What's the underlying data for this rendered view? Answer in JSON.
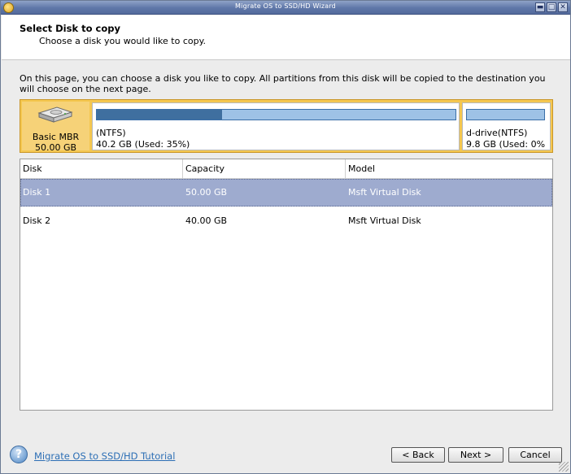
{
  "window": {
    "title": "Migrate OS to SSD/HD Wizard",
    "minimize_glyph": "▬",
    "maximize_glyph": "□",
    "close_glyph": "✕"
  },
  "header": {
    "title": "Select Disk to copy",
    "subtitle": "Choose a disk you would like to copy."
  },
  "intro": "On this page, you can choose a disk you like to copy. All partitions from this disk will be copied to the destination you will choose on the next page.",
  "disk_map": {
    "disk_type": "Basic MBR",
    "disk_size": "50.00 GB",
    "partitions": [
      {
        "label": "(NTFS)",
        "usage": "40.2 GB (Used: 35%)",
        "used_fraction": 0.35
      },
      {
        "label": "d-drive(NTFS)",
        "usage": "9.8 GB (Used: 0%",
        "used_fraction": 0.0
      }
    ]
  },
  "table": {
    "columns": [
      "Disk",
      "Capacity",
      "Model"
    ],
    "rows": [
      {
        "disk": "Disk 1",
        "capacity": "50.00 GB",
        "model": "Msft Virtual Disk",
        "selected": true
      },
      {
        "disk": "Disk 2",
        "capacity": "40.00 GB",
        "model": "Msft Virtual Disk",
        "selected": false
      }
    ]
  },
  "footer": {
    "help_glyph": "?",
    "tutorial_link": "Migrate OS to SSD/HD Tutorial",
    "back_label": "< Back",
    "next_label": "Next >",
    "cancel_label": "Cancel"
  },
  "colors": {
    "selection": "#9eabcf",
    "disk_map_bg": "#f4c750",
    "partition_used": "#3f6f9f",
    "partition_free": "#9ec2e6",
    "link": "#2d6fb5"
  }
}
